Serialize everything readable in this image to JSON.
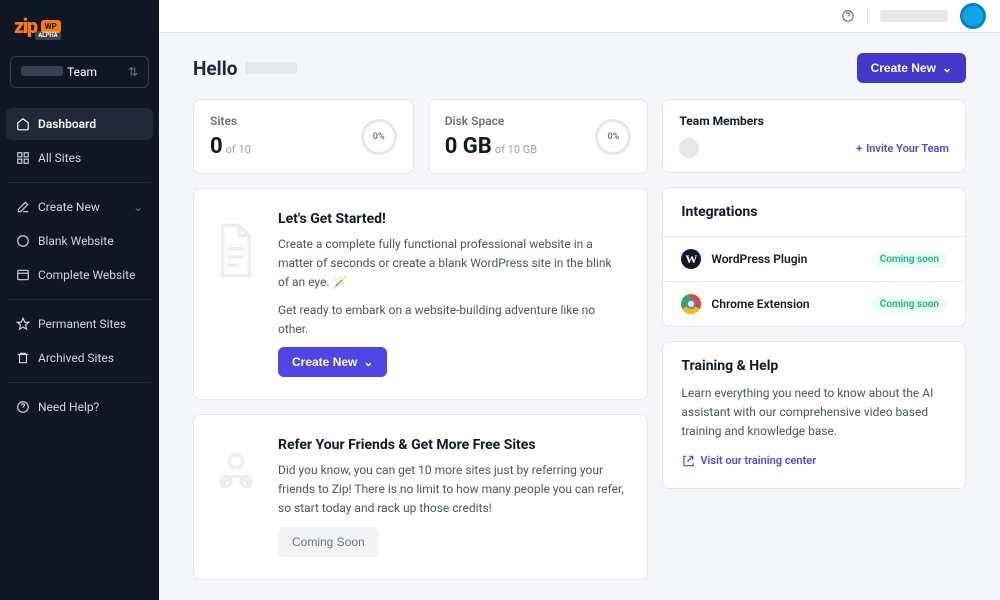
{
  "sidebar": {
    "team_label": "Team",
    "nav": {
      "dashboard": "Dashboard",
      "all_sites": "All Sites",
      "create_new": "Create New",
      "blank_website": "Blank Website",
      "complete_website": "Complete Website",
      "permanent_sites": "Permanent Sites",
      "archived_sites": "Archived Sites",
      "need_help": "Need Help?"
    }
  },
  "header": {
    "hello": "Hello",
    "create_new": "Create New"
  },
  "stats": {
    "sites": {
      "label": "Sites",
      "value": "0",
      "of": "of 10",
      "pct": "0%"
    },
    "disk": {
      "label": "Disk Space",
      "value": "0 GB",
      "of": "of 10 GB",
      "pct": "0%"
    }
  },
  "team": {
    "title": "Team Members",
    "invite": "Invite Your Team"
  },
  "get_started": {
    "title": "Let's Get Started!",
    "line1": "Create a complete fully functional professional website in a matter of seconds or create a blank WordPress site in the blink of an eye. 🪄",
    "line2": "Get ready to embark on a website-building adventure like no other.",
    "cta": "Create New"
  },
  "refer": {
    "title": "Refer Your Friends & Get More Free Sites",
    "text": "Did you know, you can get 10 more sites just by referring your friends to Zip! There is no limit to how many people you can refer, so start today and rack up those credits!",
    "cta": "Coming Soon"
  },
  "integrations": {
    "title": "Integrations",
    "wp": "WordPress Plugin",
    "chrome": "Chrome Extension",
    "badge": "Coming soon"
  },
  "help": {
    "title": "Training & Help",
    "text": "Learn everything you need to know about the AI assistant with our comprehensive video based training and knowledge base.",
    "link": "Visit our training center"
  }
}
